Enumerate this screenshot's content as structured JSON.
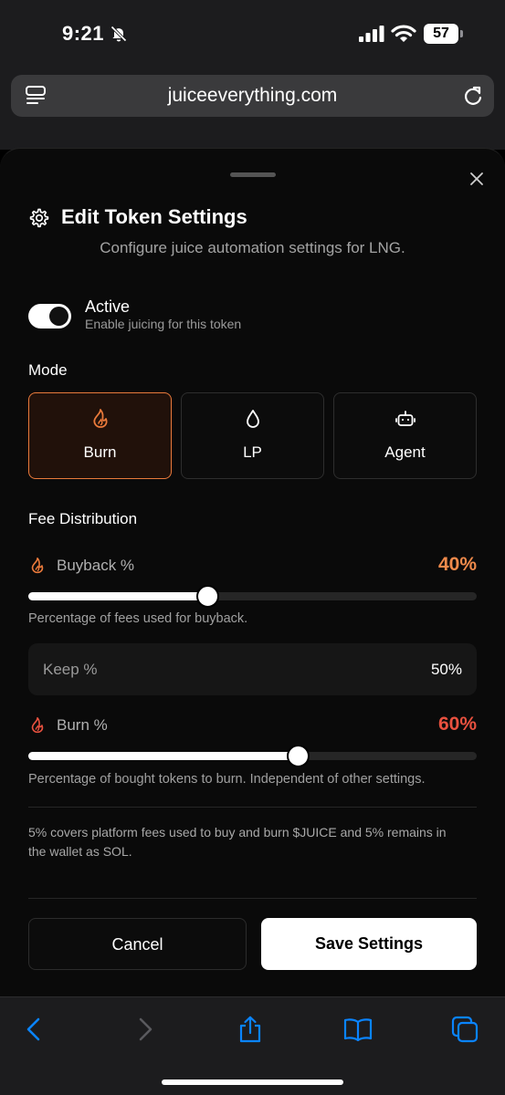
{
  "status_bar": {
    "time": "9:21",
    "battery": "57",
    "icons": [
      "bell-slash-icon",
      "signal-icon",
      "wifi-icon",
      "battery-icon"
    ]
  },
  "browser": {
    "url": "juiceeverything.com"
  },
  "dialog": {
    "title": "Edit Token Settings",
    "subtitle": "Configure juice automation settings for LNG.",
    "active": {
      "label": "Active",
      "description": "Enable juicing for this token",
      "enabled": true
    },
    "mode": {
      "label": "Mode",
      "options": [
        {
          "label": "Burn",
          "icon": "flame-icon",
          "selected": true
        },
        {
          "label": "LP",
          "icon": "droplet-icon",
          "selected": false
        },
        {
          "label": "Agent",
          "icon": "bot-icon",
          "selected": false
        }
      ]
    },
    "fee_distribution": {
      "title": "Fee Distribution",
      "buyback": {
        "label": "Buyback %",
        "value_text": "40%",
        "value": 40,
        "hint": "Percentage of fees used for buyback."
      },
      "keep": {
        "label": "Keep %",
        "value_text": "50%"
      },
      "burn": {
        "label": "Burn %",
        "value_text": "60%",
        "value": 60,
        "hint": "Percentage of bought tokens to burn. Independent of other settings."
      }
    },
    "note": "5% covers platform fees used to buy and burn $JUICE and 5% remains in the wallet as SOL.",
    "buttons": {
      "cancel": "Cancel",
      "save": "Save Settings"
    }
  },
  "colors": {
    "accent_orange": "#ea7a3b",
    "buyback_value": "#f08a4b",
    "burn_value": "#e8513f",
    "ios_blue": "#0a84ff"
  }
}
